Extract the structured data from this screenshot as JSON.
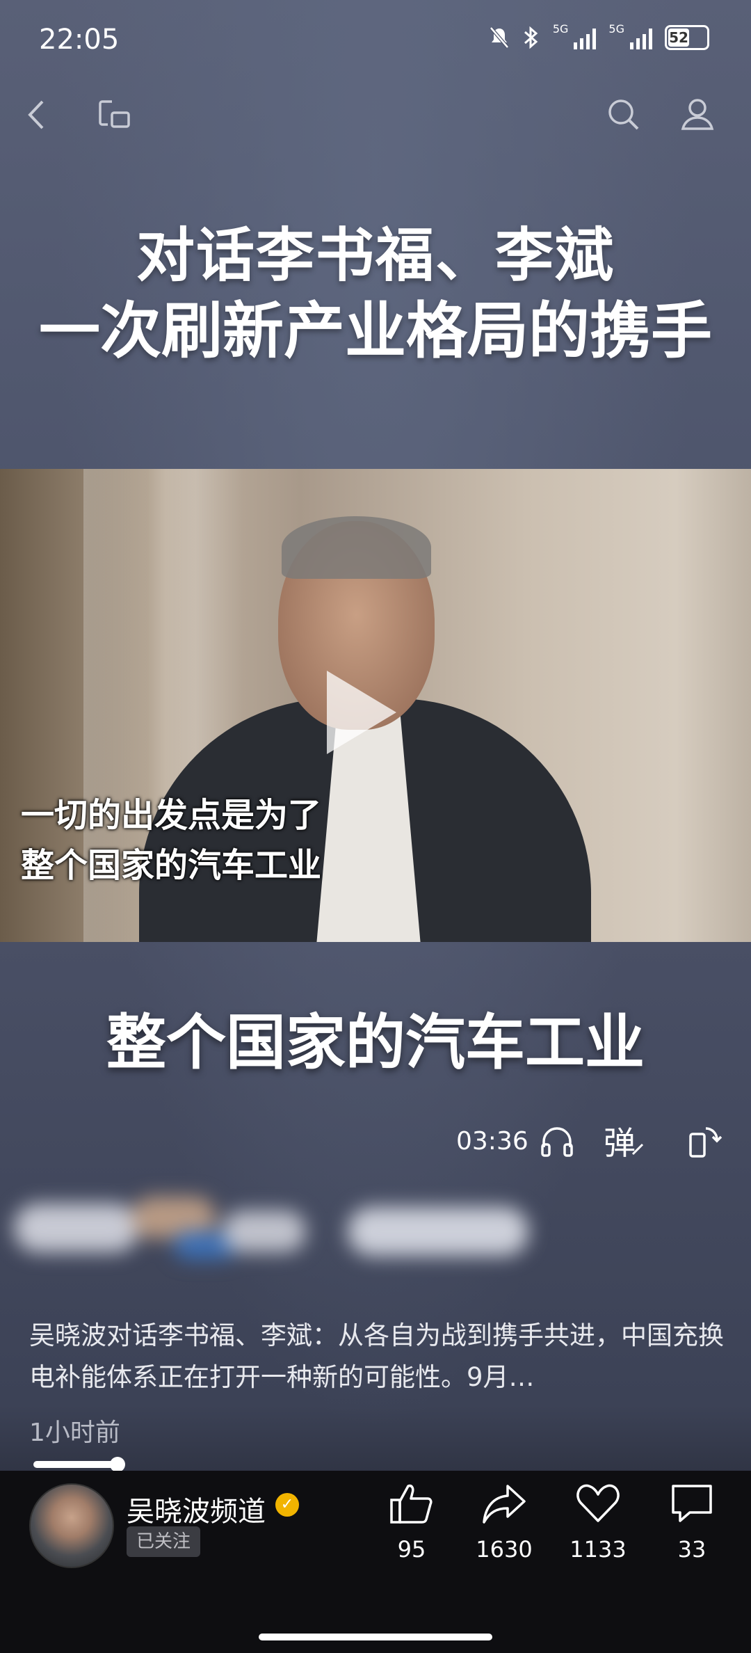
{
  "status_bar": {
    "time": "22:05",
    "network_1": "5G",
    "network_2": "5G",
    "battery": "52"
  },
  "title": {
    "line1": "对话李书福、李斌",
    "line2": "一次刷新产业格局的携手"
  },
  "video": {
    "subtitle_line1": "一切的出发点是为了",
    "subtitle_line2": "整个国家的汽车工业",
    "big_caption": "整个国家的汽车工业"
  },
  "controls": {
    "duration": "03:36",
    "danmu": "弹"
  },
  "description": {
    "text": "吴晓波对话李书福、李斌：从各自为战到携手共进，中国充换电补能体系正在打开一种新的可能性。9月…",
    "time_ago": "1小时前"
  },
  "playback": {
    "progress": 0.15
  },
  "author": {
    "name": "吴晓波频道",
    "follow_status": "已关注"
  },
  "actions": {
    "likes": "95",
    "shares": "1630",
    "favorites": "1133",
    "comments": "33"
  }
}
